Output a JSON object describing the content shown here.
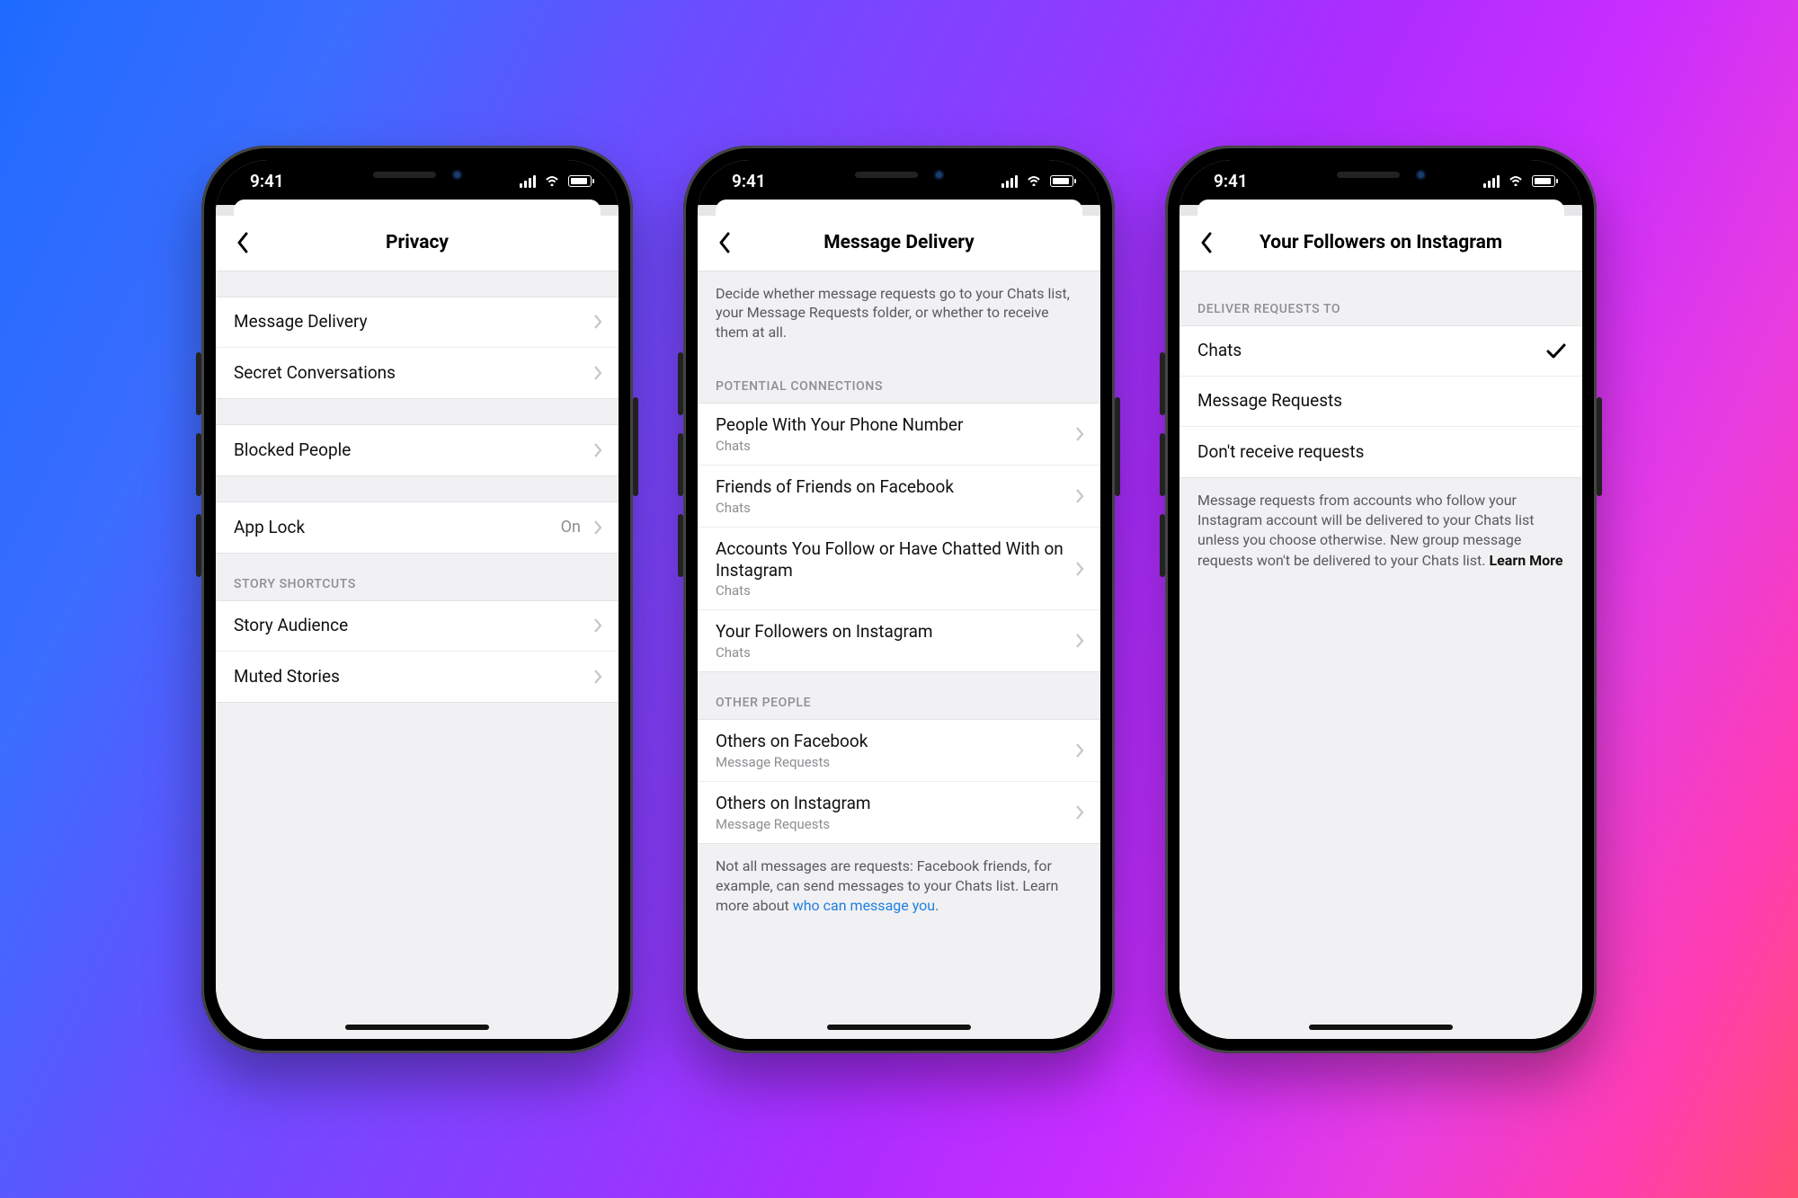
{
  "status": {
    "time": "9:41"
  },
  "phone1": {
    "title": "Privacy",
    "groups": [
      {
        "header": null,
        "rows": [
          {
            "label": "Message Delivery",
            "sub": null,
            "value": null
          },
          {
            "label": "Secret Conversations",
            "sub": null,
            "value": null
          }
        ]
      },
      {
        "header": null,
        "rows": [
          {
            "label": "Blocked People",
            "sub": null,
            "value": null
          }
        ]
      },
      {
        "header": null,
        "rows": [
          {
            "label": "App Lock",
            "sub": null,
            "value": "On"
          }
        ]
      },
      {
        "header": "STORY SHORTCUTS",
        "rows": [
          {
            "label": "Story Audience",
            "sub": null,
            "value": null
          },
          {
            "label": "Muted Stories",
            "sub": null,
            "value": null
          }
        ]
      }
    ]
  },
  "phone2": {
    "title": "Message Delivery",
    "description": "Decide whether message requests go to your Chats list, your Message Requests folder, or whether to receive them at all.",
    "groups": [
      {
        "header": "POTENTIAL CONNECTIONS",
        "rows": [
          {
            "label": "People With Your Phone Number",
            "sub": "Chats"
          },
          {
            "label": "Friends of Friends on Facebook",
            "sub": "Chats"
          },
          {
            "label": "Accounts You Follow or Have Chatted With on Instagram",
            "sub": "Chats"
          },
          {
            "label": "Your Followers on Instagram",
            "sub": "Chats"
          }
        ]
      },
      {
        "header": "OTHER PEOPLE",
        "rows": [
          {
            "label": "Others on Facebook",
            "sub": "Message Requests"
          },
          {
            "label": "Others on Instagram",
            "sub": "Message Requests"
          }
        ]
      }
    ],
    "footnote_prefix": "Not all messages are requests: Facebook friends, for example, can send messages to your Chats list. Learn more about ",
    "footnote_link": "who can message you",
    "footnote_suffix": "."
  },
  "phone3": {
    "title": "Your Followers on Instagram",
    "section_header": "DELIVER REQUESTS TO",
    "options": [
      {
        "label": "Chats",
        "selected": true
      },
      {
        "label": "Message Requests",
        "selected": false
      },
      {
        "label": "Don't receive requests",
        "selected": false
      }
    ],
    "footnote_prefix": "Message requests from accounts who follow your Instagram account will be delivered to your Chats list unless you choose otherwise. New group message requests won't be delivered to your Chats list. ",
    "footnote_strong": "Learn More"
  }
}
